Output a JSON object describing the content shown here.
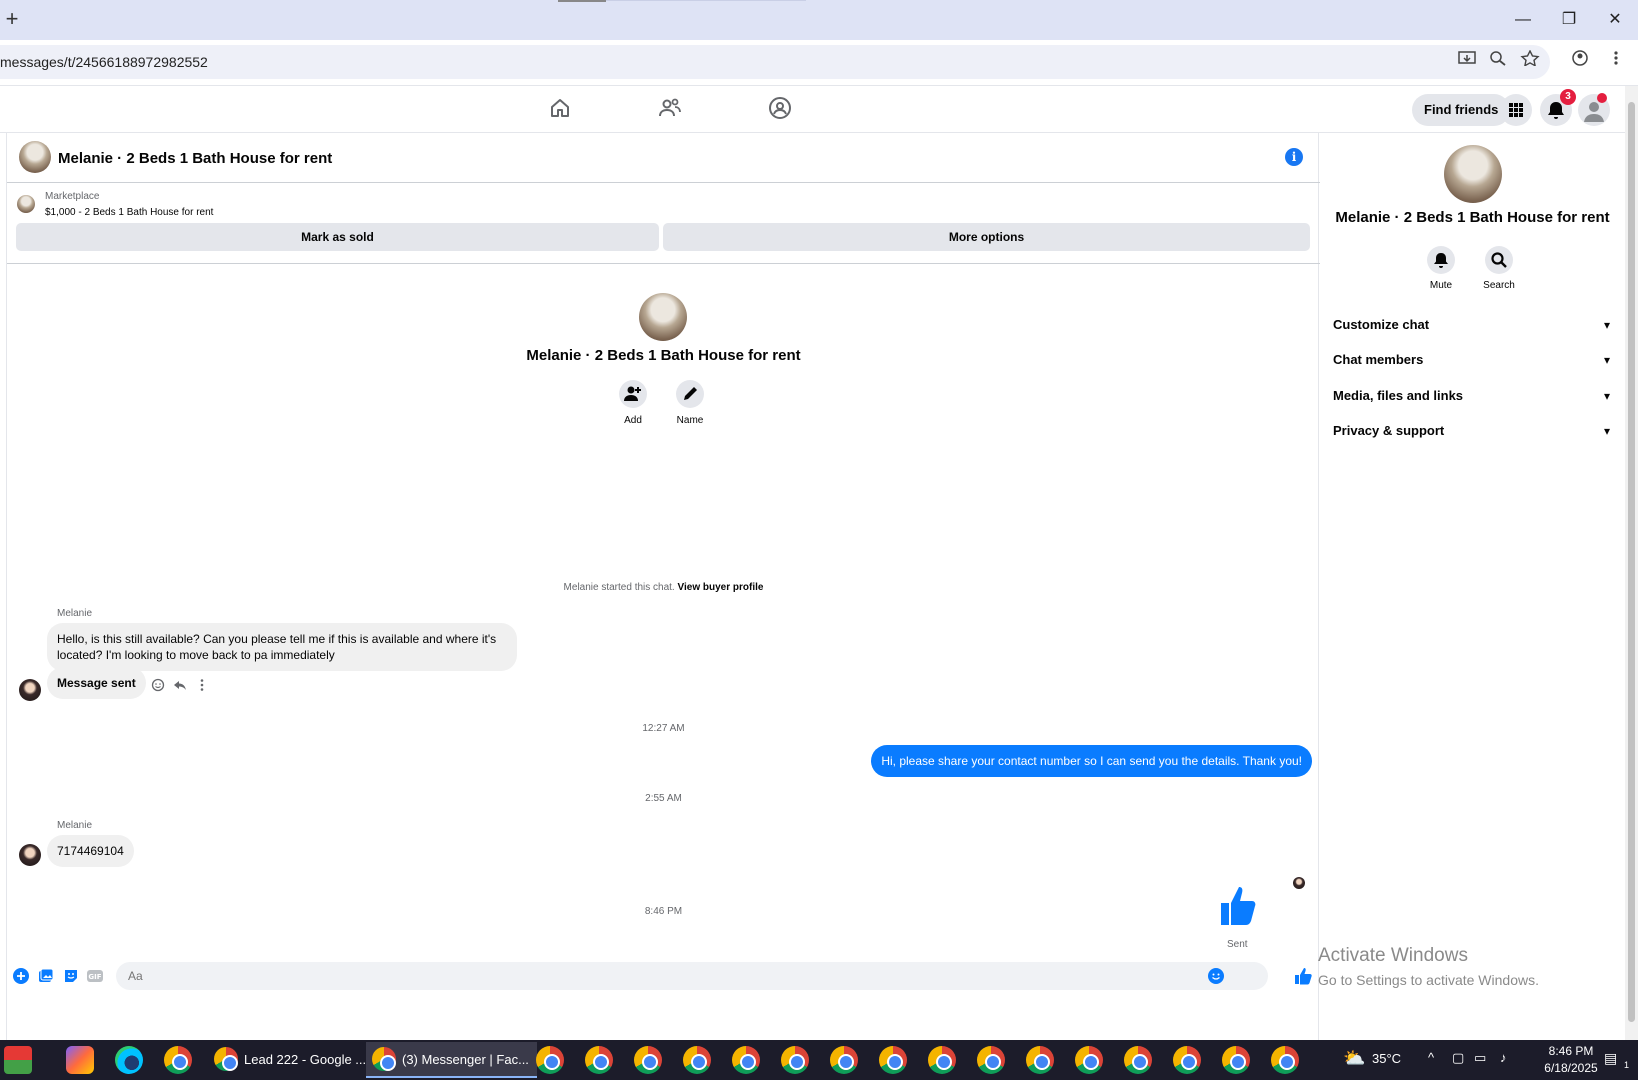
{
  "browser": {
    "url": "messages/t/24566188972982552",
    "new_tab_symbol": "+",
    "window_controls": {
      "minimize": "—",
      "restore": "❐",
      "close": "✕"
    }
  },
  "fb_nav": {
    "find_friends_label": "Find friends",
    "notification_count": "3"
  },
  "chat": {
    "title": "Melanie · 2 Beds 1 Bath House for rent",
    "info_symbol": "i",
    "marketplace": {
      "label": "Marketplace",
      "listing": "$1,000 - 2 Beds 1 Bath House for rent",
      "mark_sold_label": "Mark as sold",
      "more_options_label": "More options"
    },
    "conversation_header": {
      "title": "Melanie · 2 Beds 1 Bath House for rent",
      "add_label": "Add",
      "name_label": "Name"
    },
    "system_message": {
      "text": "Melanie started this chat.",
      "link": "View buyer profile"
    },
    "messages": [
      {
        "sender": "Melanie",
        "text": "Hello, is this still available?  Can you please tell me if this is available and where it's located? I'm looking to move back to pa immediately"
      },
      {
        "text": "Message sent"
      },
      {
        "timestamp": "12:27 AM"
      },
      {
        "text": "Hi, please share your contact number so I can send you the details. Thank you!"
      },
      {
        "timestamp": "2:55 AM"
      },
      {
        "sender": "Melanie",
        "text": "7174469104"
      },
      {
        "timestamp": "8:46 PM"
      }
    ],
    "sent_label": "Sent",
    "composer_placeholder": "Aa"
  },
  "right_panel": {
    "title": "Melanie · 2 Beds 1 Bath House for rent",
    "mute_label": "Mute",
    "search_label": "Search",
    "sections": [
      "Customize chat",
      "Chat members",
      "Media, files and links",
      "Privacy & support"
    ]
  },
  "watermark": {
    "line1": "Activate Windows",
    "line2": "Go to Settings to activate Windows."
  },
  "taskbar": {
    "task1": "Lead 222 - Google ...",
    "task2": "(3) Messenger | Fac...",
    "weather": "35°C",
    "time": "8:46 PM",
    "date": "6/18/2025",
    "notif_count": "1"
  },
  "colors": {
    "accent": "#0a7cff",
    "fb_blue": "#1877f2",
    "badge": "#e41e3f"
  }
}
